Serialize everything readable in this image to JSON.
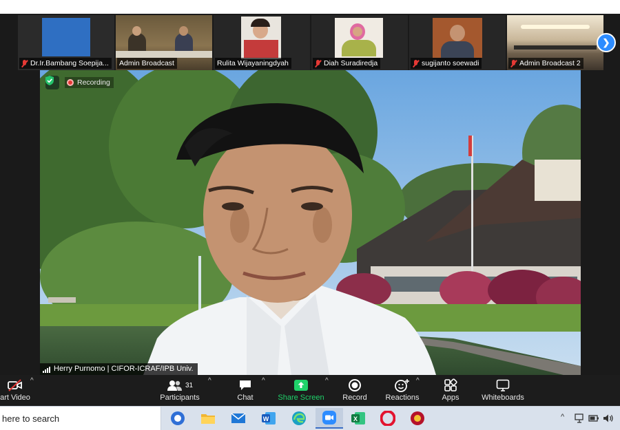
{
  "thumbnails": [
    {
      "name": "Dr.Ir.Bambang Soepija...",
      "muted": true
    },
    {
      "name": "Admin Broadcast",
      "muted": false
    },
    {
      "name": "Rulita Wijayaningdyah",
      "muted": false
    },
    {
      "name": "Diah Suradiredja",
      "muted": true
    },
    {
      "name": "sugijanto soewadi",
      "muted": true
    },
    {
      "name": "Admin Broadcast 2",
      "muted": true
    }
  ],
  "main_video": {
    "recording_label": "Recording",
    "speaker_name": "Herry Purnomo | CIFOR-ICRAF/IPB Univ."
  },
  "toolbar": {
    "start_video": "art Video",
    "participants": "Participants",
    "participants_count": "31",
    "chat": "Chat",
    "share_screen": "Share Screen",
    "record": "Record",
    "reactions": "Reactions",
    "apps": "Apps",
    "whiteboards": "Whiteboards"
  },
  "taskbar": {
    "search_placeholder": "here to search"
  },
  "colors": {
    "zoom_background": "#1a1a1a",
    "share_green": "#1fd26a",
    "zoom_blue": "#2d8cff",
    "muted_red": "#e53935",
    "taskbar": "#d9e1ec"
  }
}
